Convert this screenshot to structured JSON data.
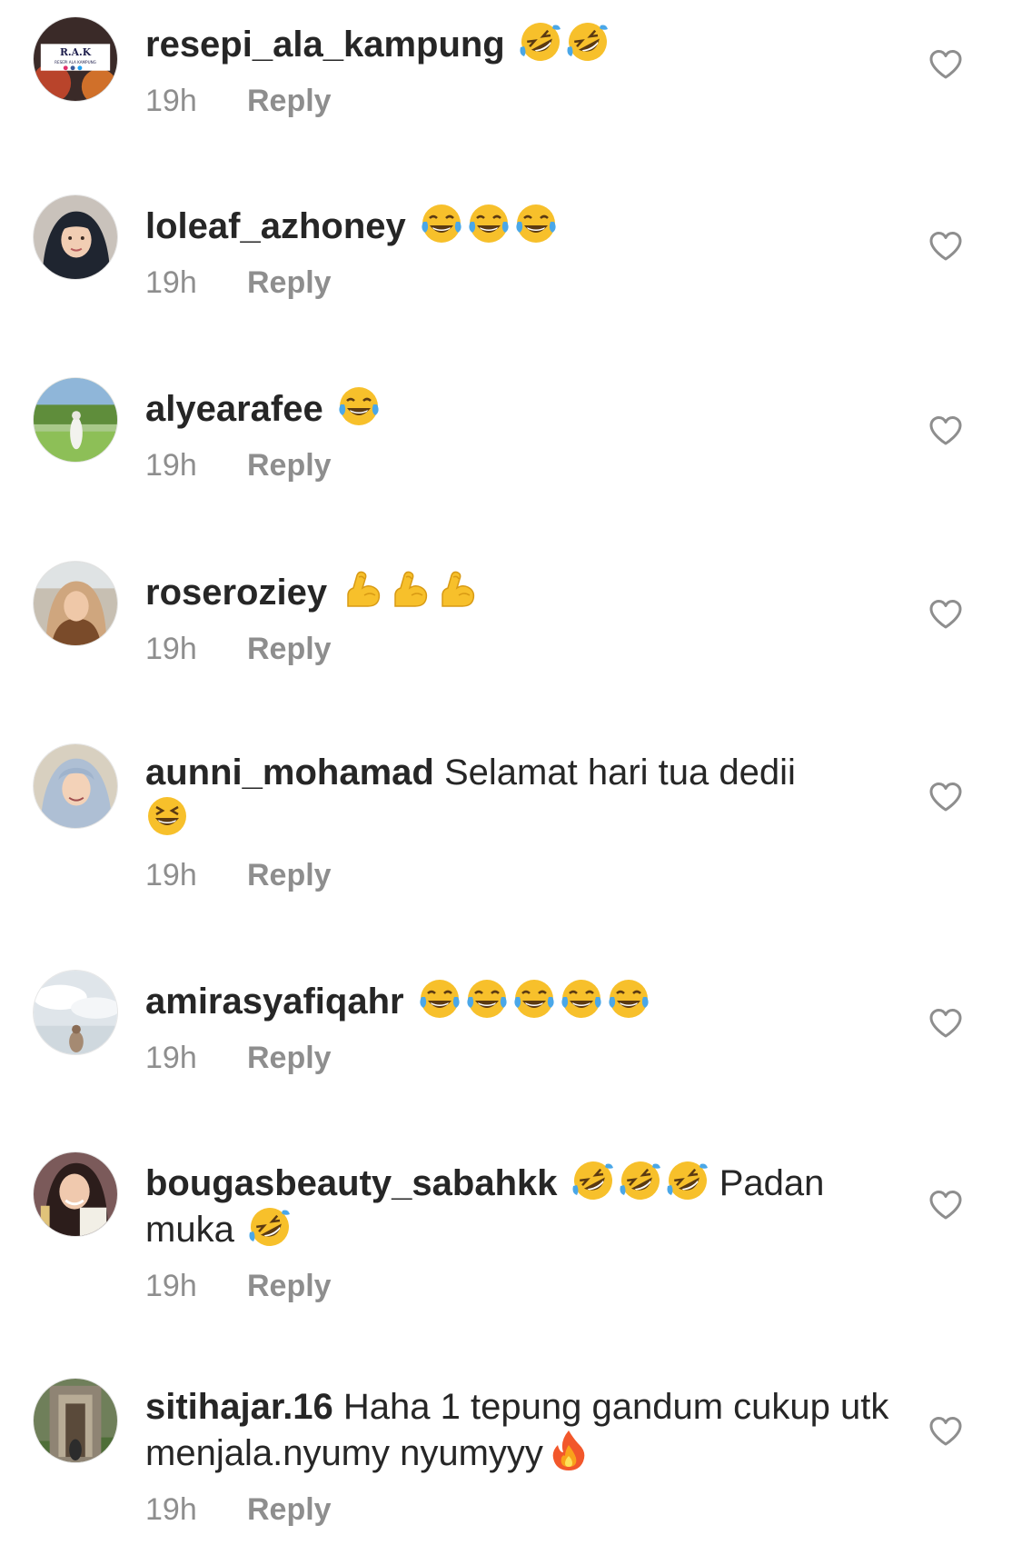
{
  "comments": [
    {
      "username": "resepi_ala_kampung",
      "text": "",
      "emojis": [
        "rofl",
        "rofl"
      ],
      "text_after": "",
      "time": "19h",
      "reply_label": "Reply",
      "avatar_text": "R.A.K",
      "avatar_subtext": "RESEPI ALA KAMPUNG"
    },
    {
      "username": "loleaf_azhoney",
      "text": "",
      "emojis": [
        "joy",
        "joy",
        "joy"
      ],
      "text_after": "",
      "time": "19h",
      "reply_label": "Reply"
    },
    {
      "username": "alyearafee",
      "text": "",
      "emojis": [
        "joy"
      ],
      "text_after": "",
      "time": "19h",
      "reply_label": "Reply"
    },
    {
      "username": "roseroziey",
      "text": "",
      "emojis": [
        "muscle",
        "muscle",
        "muscle"
      ],
      "text_after": "",
      "time": "19h",
      "reply_label": "Reply"
    },
    {
      "username": "aunni_mohamad",
      "text": "Selamat hari tua dedii",
      "emojis": [
        "laughing"
      ],
      "text_after": "",
      "time": "19h",
      "reply_label": "Reply"
    },
    {
      "username": "amirasyafiqahr",
      "text": "",
      "emojis": [
        "joy",
        "joy",
        "joy",
        "joy",
        "joy"
      ],
      "text_after": "",
      "time": "19h",
      "reply_label": "Reply"
    },
    {
      "username": "bougasbeauty_sabahkk",
      "text": "",
      "emojis": [
        "rofl",
        "rofl",
        "rofl"
      ],
      "text_after": "Padan muka",
      "emojis_after": [
        "rofl"
      ],
      "time": "19h",
      "reply_label": "Reply"
    },
    {
      "username": "sitihajar.16",
      "text": "Haha 1 tepung gandum cukup utk menjala.nyumy nyumyyy",
      "emojis": [
        "fire"
      ],
      "text_after": "",
      "time": "19h",
      "reply_label": "Reply"
    }
  ],
  "colors": {
    "text": "#262626",
    "meta": "#8e8e8e",
    "heart_stroke": "#8e8e8e",
    "emoji_face": "#f7c02b"
  }
}
